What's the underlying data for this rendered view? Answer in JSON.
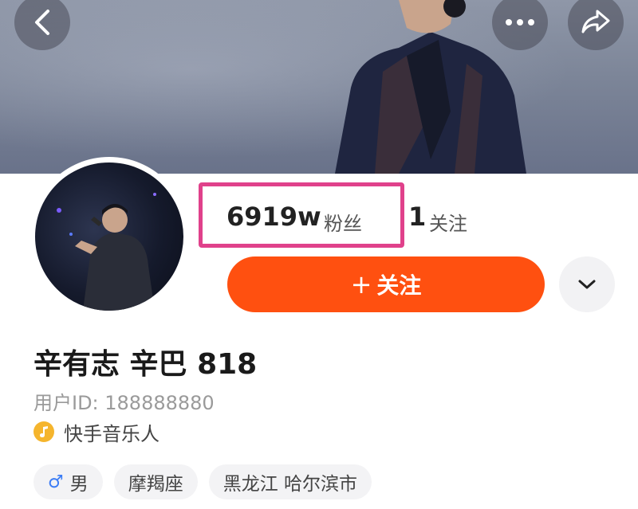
{
  "header": {
    "back_icon": "chevron-left-icon",
    "more_icon": "ellipsis-icon",
    "share_icon": "share-arrow-icon"
  },
  "profile": {
    "fans_count": "6919w",
    "fans_label": "粉丝",
    "following_count": "1",
    "following_label": "关注",
    "follow_button_label": "关注",
    "name": "辛有志 辛巴 818",
    "user_id": "用户ID: 188888880",
    "role_label": "快手音乐人",
    "tags": {
      "gender": "男",
      "zodiac": "摩羯座",
      "location": "黑龙江 哈尔滨市"
    }
  },
  "colors": {
    "follow_button": "#ff5010",
    "highlight_box": "#e0418b",
    "role_icon": "#f5b52d",
    "gender_icon": "#3b7cf5"
  }
}
